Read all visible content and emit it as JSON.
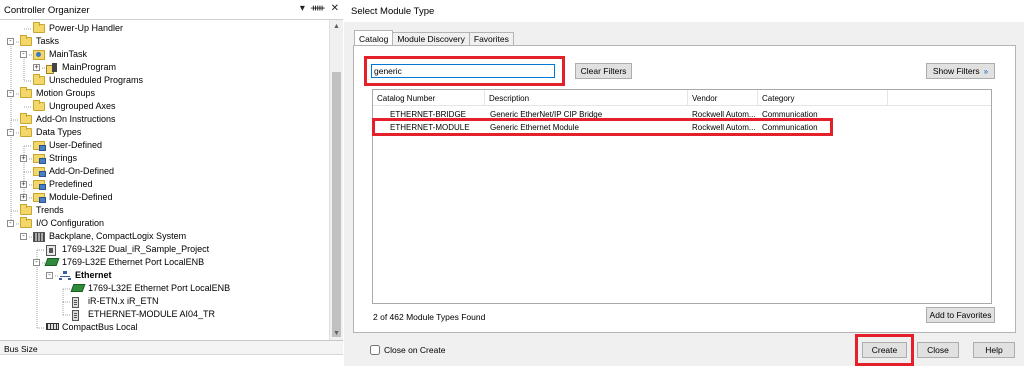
{
  "organizer": {
    "title": "Controller Organizer",
    "title_buttons": [
      "▾",
      "ᚔ",
      "✕"
    ],
    "status_label": "Bus Size",
    "tree": [
      {
        "label": "Power-Up Handler",
        "icon": "folder-icon",
        "depth": 2,
        "expander": null
      },
      {
        "label": "Tasks",
        "icon": "folder-icon",
        "depth": 1,
        "expander": "-"
      },
      {
        "label": "MainTask",
        "icon": "task-icon",
        "depth": 2,
        "expander": "-"
      },
      {
        "label": "MainProgram",
        "icon": "program-icon",
        "depth": 3,
        "expander": "+"
      },
      {
        "label": "Unscheduled Programs",
        "icon": "folder-icon",
        "depth": 2,
        "expander": null
      },
      {
        "label": "Motion Groups",
        "icon": "folder-icon",
        "depth": 1,
        "expander": "-"
      },
      {
        "label": "Ungrouped Axes",
        "icon": "folder-icon",
        "depth": 2,
        "expander": null
      },
      {
        "label": "Add-On Instructions",
        "icon": "folder-icon",
        "depth": 1,
        "expander": null
      },
      {
        "label": "Data Types",
        "icon": "folder-icon",
        "depth": 1,
        "expander": "-"
      },
      {
        "label": "User-Defined",
        "icon": "data-type-icon",
        "depth": 2,
        "expander": null
      },
      {
        "label": "Strings",
        "icon": "data-type-icon",
        "depth": 2,
        "expander": "+"
      },
      {
        "label": "Add-On-Defined",
        "icon": "data-type-icon",
        "depth": 2,
        "expander": null
      },
      {
        "label": "Predefined",
        "icon": "data-type-icon",
        "depth": 2,
        "expander": "+"
      },
      {
        "label": "Module-Defined",
        "icon": "data-type-icon",
        "depth": 2,
        "expander": "+"
      },
      {
        "label": "Trends",
        "icon": "folder-icon",
        "depth": 1,
        "expander": null
      },
      {
        "label": "I/O Configuration",
        "icon": "folder-icon",
        "depth": 1,
        "expander": "-"
      },
      {
        "label": "Backplane, CompactLogix System",
        "icon": "chassis-icon",
        "depth": 2,
        "expander": "-"
      },
      {
        "label": "1769-L32E Dual_iR_Sample_Project",
        "icon": "controller-icon",
        "depth": 3,
        "expander": null
      },
      {
        "label": "1769-L32E Ethernet Port LocalENB",
        "icon": "ethernet-port-icon",
        "depth": 3,
        "expander": "-"
      },
      {
        "label": "Ethernet",
        "icon": "network-icon",
        "depth": 4,
        "expander": "-",
        "bold": true
      },
      {
        "label": "1769-L32E Ethernet Port LocalENB",
        "icon": "ethernet-port-icon",
        "depth": 5,
        "expander": null
      },
      {
        "label": "iR-ETN.x iR_ETN",
        "icon": "module-icon",
        "depth": 5,
        "expander": null
      },
      {
        "label": "ETHERNET-MODULE AI04_TR",
        "icon": "module-icon",
        "depth": 5,
        "expander": null
      },
      {
        "label": "CompactBus Local",
        "icon": "bus-icon",
        "depth": 3,
        "expander": null
      }
    ]
  },
  "dialog": {
    "title": "Select Module Type",
    "tabs": [
      {
        "label": "Catalog",
        "active": true
      },
      {
        "label": "Module Discovery",
        "active": false
      },
      {
        "label": "Favorites",
        "active": false
      }
    ],
    "search": {
      "value": "generic"
    },
    "clear_filters_label": "Clear Filters",
    "show_filters_label": "Show Filters",
    "columns": [
      "Catalog Number",
      "Description",
      "Vendor",
      "Category"
    ],
    "rows": [
      {
        "catalog": "ETHERNET-BRIDGE",
        "description": "Generic EtherNet/IP CIP Bridge",
        "vendor": "Rockwell Autom...",
        "category": "Communication"
      },
      {
        "catalog": "ETHERNET-MODULE",
        "description": "Generic Ethernet Module",
        "vendor": "Rockwell Autom...",
        "category": "Communication"
      }
    ],
    "found_text": "2 of 462 Module Types Found",
    "add_to_favorites_label": "Add to Favorites",
    "close_on_create_label": "Close on Create",
    "close_on_create_checked": false,
    "create_label": "Create",
    "close_label": "Close",
    "help_label": "Help"
  },
  "colors": {
    "highlight": "#e4202a",
    "input_focus": "#0078d7",
    "dialog_bg": "#f0f0f0"
  }
}
